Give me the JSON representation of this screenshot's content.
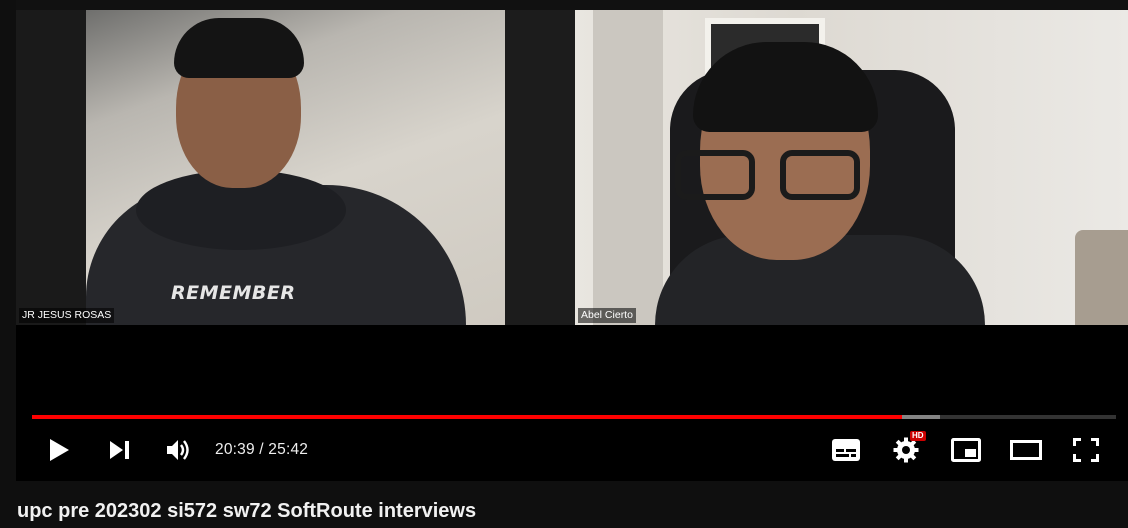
{
  "video": {
    "participants": [
      {
        "name": "JR JESUS ROSAS",
        "shirt_text": "REMEMBER"
      },
      {
        "name": "Abel Cierto"
      }
    ]
  },
  "player": {
    "progress_fraction": 0.803,
    "buffer_fraction": 0.838,
    "time_display": "20:39 / 25:42",
    "hd_badge": "HD",
    "colors": {
      "progress": "#ff0000",
      "background": "#000000"
    },
    "controls": {
      "left": [
        "play-icon",
        "next-icon",
        "volume-icon"
      ],
      "right": [
        "subtitles-icon",
        "settings-icon",
        "miniplayer-icon",
        "theater-icon",
        "fullscreen-icon"
      ]
    }
  },
  "page": {
    "title": "upc pre 202302 si572 sw72 SoftRoute interviews"
  }
}
